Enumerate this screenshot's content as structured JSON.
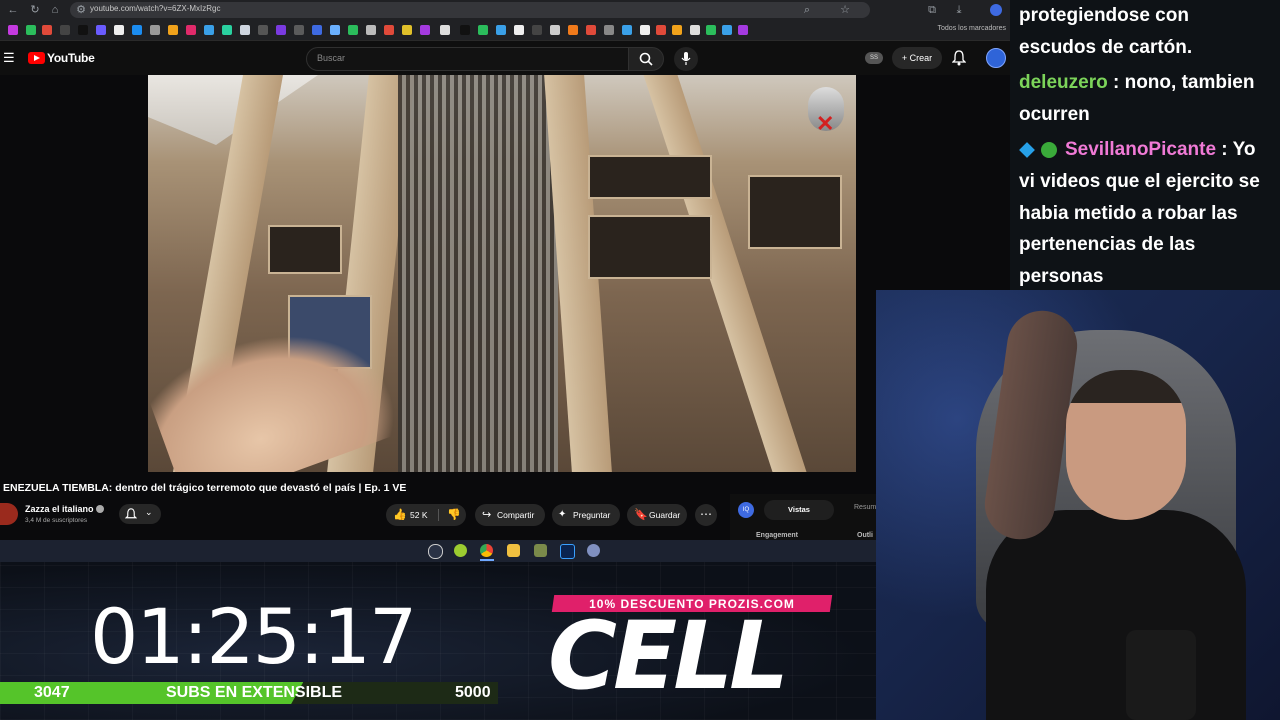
{
  "browser": {
    "url": "youtube.com/watch?v=6ZX-MxIzRgc",
    "bookmarks_folder": "Todos los marcadores"
  },
  "youtube": {
    "logo_text": "YouTube",
    "search_placeholder": "Buscar",
    "ss_badge": "SS",
    "create_label": "+ Crear"
  },
  "video": {
    "title": "ENEZUELA TIEMBLA: dentro del trágico terremoto que devastó el país | Ep. 1 VE",
    "channel_name": "Zazza el italiano",
    "subscribers": "3,4 M de suscriptores",
    "likes": "52 K",
    "share_label": "Compartir",
    "ask_label": "Preguntar",
    "save_label": "Guardar"
  },
  "side_panel": {
    "icon_text": "IQ",
    "tab_active": "Vistas",
    "tab_other": "Resum",
    "engagement_label": "Engagement",
    "outline_label": "Outli"
  },
  "overlay": {
    "timer": "01:25:17",
    "subs_current": "3047",
    "subs_label": "SUBS EN EXTENSIBLE",
    "subs_goal": "5000",
    "subs_progress": 0.609,
    "promo_text": "10% DESCUENTO PROZIS.COM",
    "sponsor_logo": "CELL"
  },
  "chat": {
    "lines": [
      {
        "text": "protegiendose con"
      },
      {
        "text": "escudos de cartón."
      },
      {
        "user": "deleuzero",
        "sep": " : ",
        "text": "nono, tambien"
      },
      {
        "text": "ocurren"
      },
      {
        "user": "SevillanoPicante",
        "sep": " : ",
        "text": "Yo"
      },
      {
        "text": "vi videos que el ejercito se"
      },
      {
        "text": "habia metido a robar las"
      },
      {
        "text": "pertenencias de las"
      },
      {
        "text": "personas"
      }
    ]
  },
  "colors": {
    "accent_red": "#ff0000",
    "subs_green": "#55c42a",
    "promo_pink": "#e0206a",
    "chat_user_green": "#7cd45a",
    "chat_user_pink": "#f07ad6"
  }
}
